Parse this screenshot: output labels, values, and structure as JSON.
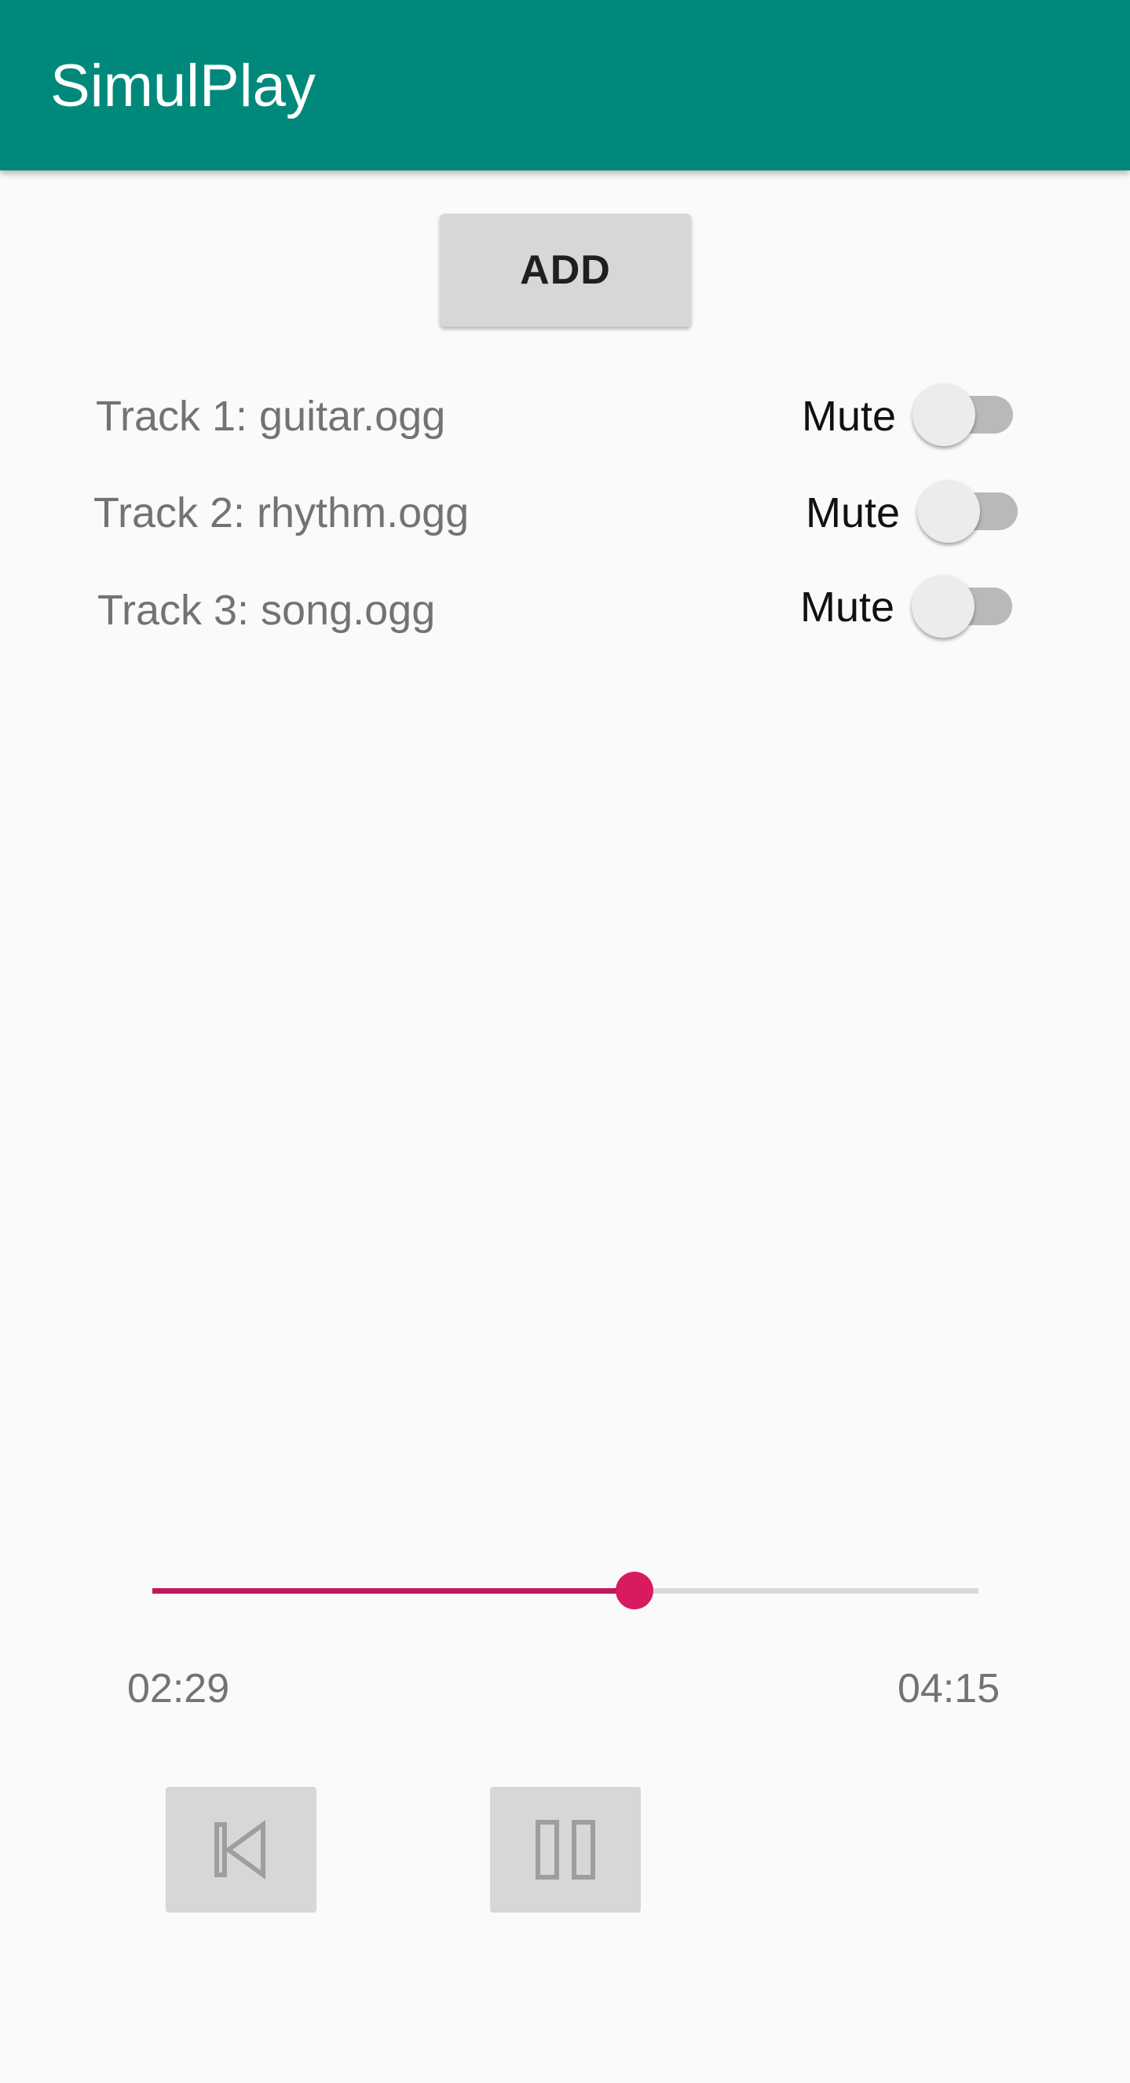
{
  "app": {
    "title": "SimulPlay"
  },
  "add_button": {
    "label": "ADD"
  },
  "tracks": [
    {
      "label": "Track 1: guitar.ogg",
      "mute_label": "Mute",
      "muted": false
    },
    {
      "label": "Track 2: rhythm.ogg",
      "mute_label": "Mute",
      "muted": false
    },
    {
      "label": "Track 3: song.ogg",
      "mute_label": "Mute",
      "muted": false
    }
  ],
  "player": {
    "elapsed": "02:29",
    "total": "04:15",
    "progress_fraction": 0.584
  },
  "controls": {
    "previous_icon": "skip-previous-icon",
    "pause_icon": "pause-icon"
  },
  "colors": {
    "app_bar": "#00897b",
    "seek_accent": "#d81b60",
    "background": "#fafafa"
  }
}
